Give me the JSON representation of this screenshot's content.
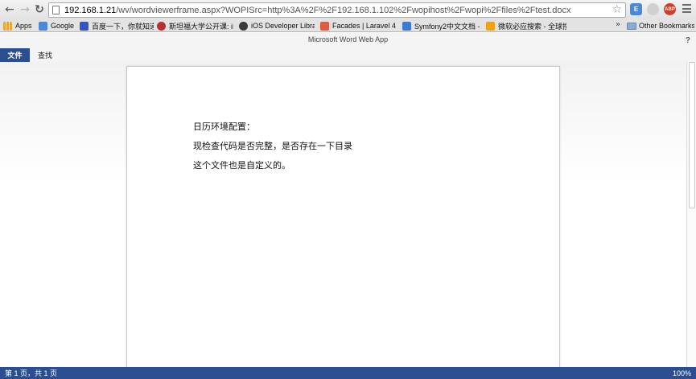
{
  "browser": {
    "url_host": "192.168.1.21",
    "url_rest": "/wv/wordviewerframe.aspx?WOPISrc=http%3A%2F%2F192.168.1.102%2Fwopihost%2Fwopi%2Ffiles%2Ftest.docx",
    "icons": {
      "back": "back-arrow-icon",
      "forward": "forward-arrow-icon",
      "reload": "reload-icon",
      "star": "star-icon",
      "menu": "hamburger-menu-icon"
    },
    "extensions": [
      "E",
      "",
      "ABP"
    ]
  },
  "bookmarks": {
    "items": [
      {
        "label": "Apps",
        "color": "#e8a33b"
      },
      {
        "label": "Google",
        "color": "#4a88da"
      },
      {
        "label": "百度一下，你就知道",
        "color": "#3056c9"
      },
      {
        "label": "斯坦福大学公开课: iF",
        "color": "#b8312f"
      },
      {
        "label": "iOS Developer Libra",
        "color": "#3a3a3a"
      },
      {
        "label": "Facades | Laravel 4",
        "color": "#e35a3c"
      },
      {
        "label": "Symfony2中文文档 - ",
        "color": "#3a7bd5"
      },
      {
        "label": "微软必应搜索 - 全球搜",
        "color": "#f0a30a"
      }
    ],
    "more": "»",
    "other": "Other Bookmarks"
  },
  "app": {
    "title": "Microsoft Word Web App",
    "help": "?",
    "tabs": [
      "文件",
      "查找"
    ]
  },
  "document": {
    "paragraphs": [
      "日历环境配置：",
      "现检查代码是否完整，是否存在一下目录",
      "这个文件也是自定义的。"
    ]
  },
  "status": {
    "page_info": "第 1 页，共 1 页",
    "zoom": "100%"
  }
}
